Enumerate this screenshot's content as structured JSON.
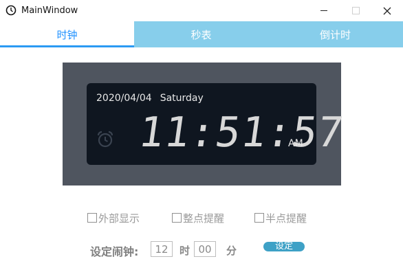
{
  "window": {
    "title": "MainWindow"
  },
  "tabs": [
    {
      "label": "时钟",
      "active": true
    },
    {
      "label": "秒表",
      "active": false
    },
    {
      "label": "倒计时",
      "active": false
    }
  ],
  "clock": {
    "date": "2020/04/04",
    "weekday": "Saturday",
    "time": "11:51:57",
    "ampm": "AM"
  },
  "options": [
    {
      "label": "外部显示",
      "checked": false
    },
    {
      "label": "整点提醒",
      "checked": false
    },
    {
      "label": "半点提醒",
      "checked": false
    }
  ],
  "alarm": {
    "label": "设定闹钟:",
    "hour": "12",
    "hour_unit": "时",
    "minute": "00",
    "minute_unit": "分",
    "set_button": "设定"
  },
  "colors": {
    "tab_bar": "#87ceeb",
    "active_tab_text": "#1e90ff",
    "panel_bg": "#4f555f",
    "lcd_bg": "#0f1620",
    "set_button": "#3ea1c6"
  }
}
